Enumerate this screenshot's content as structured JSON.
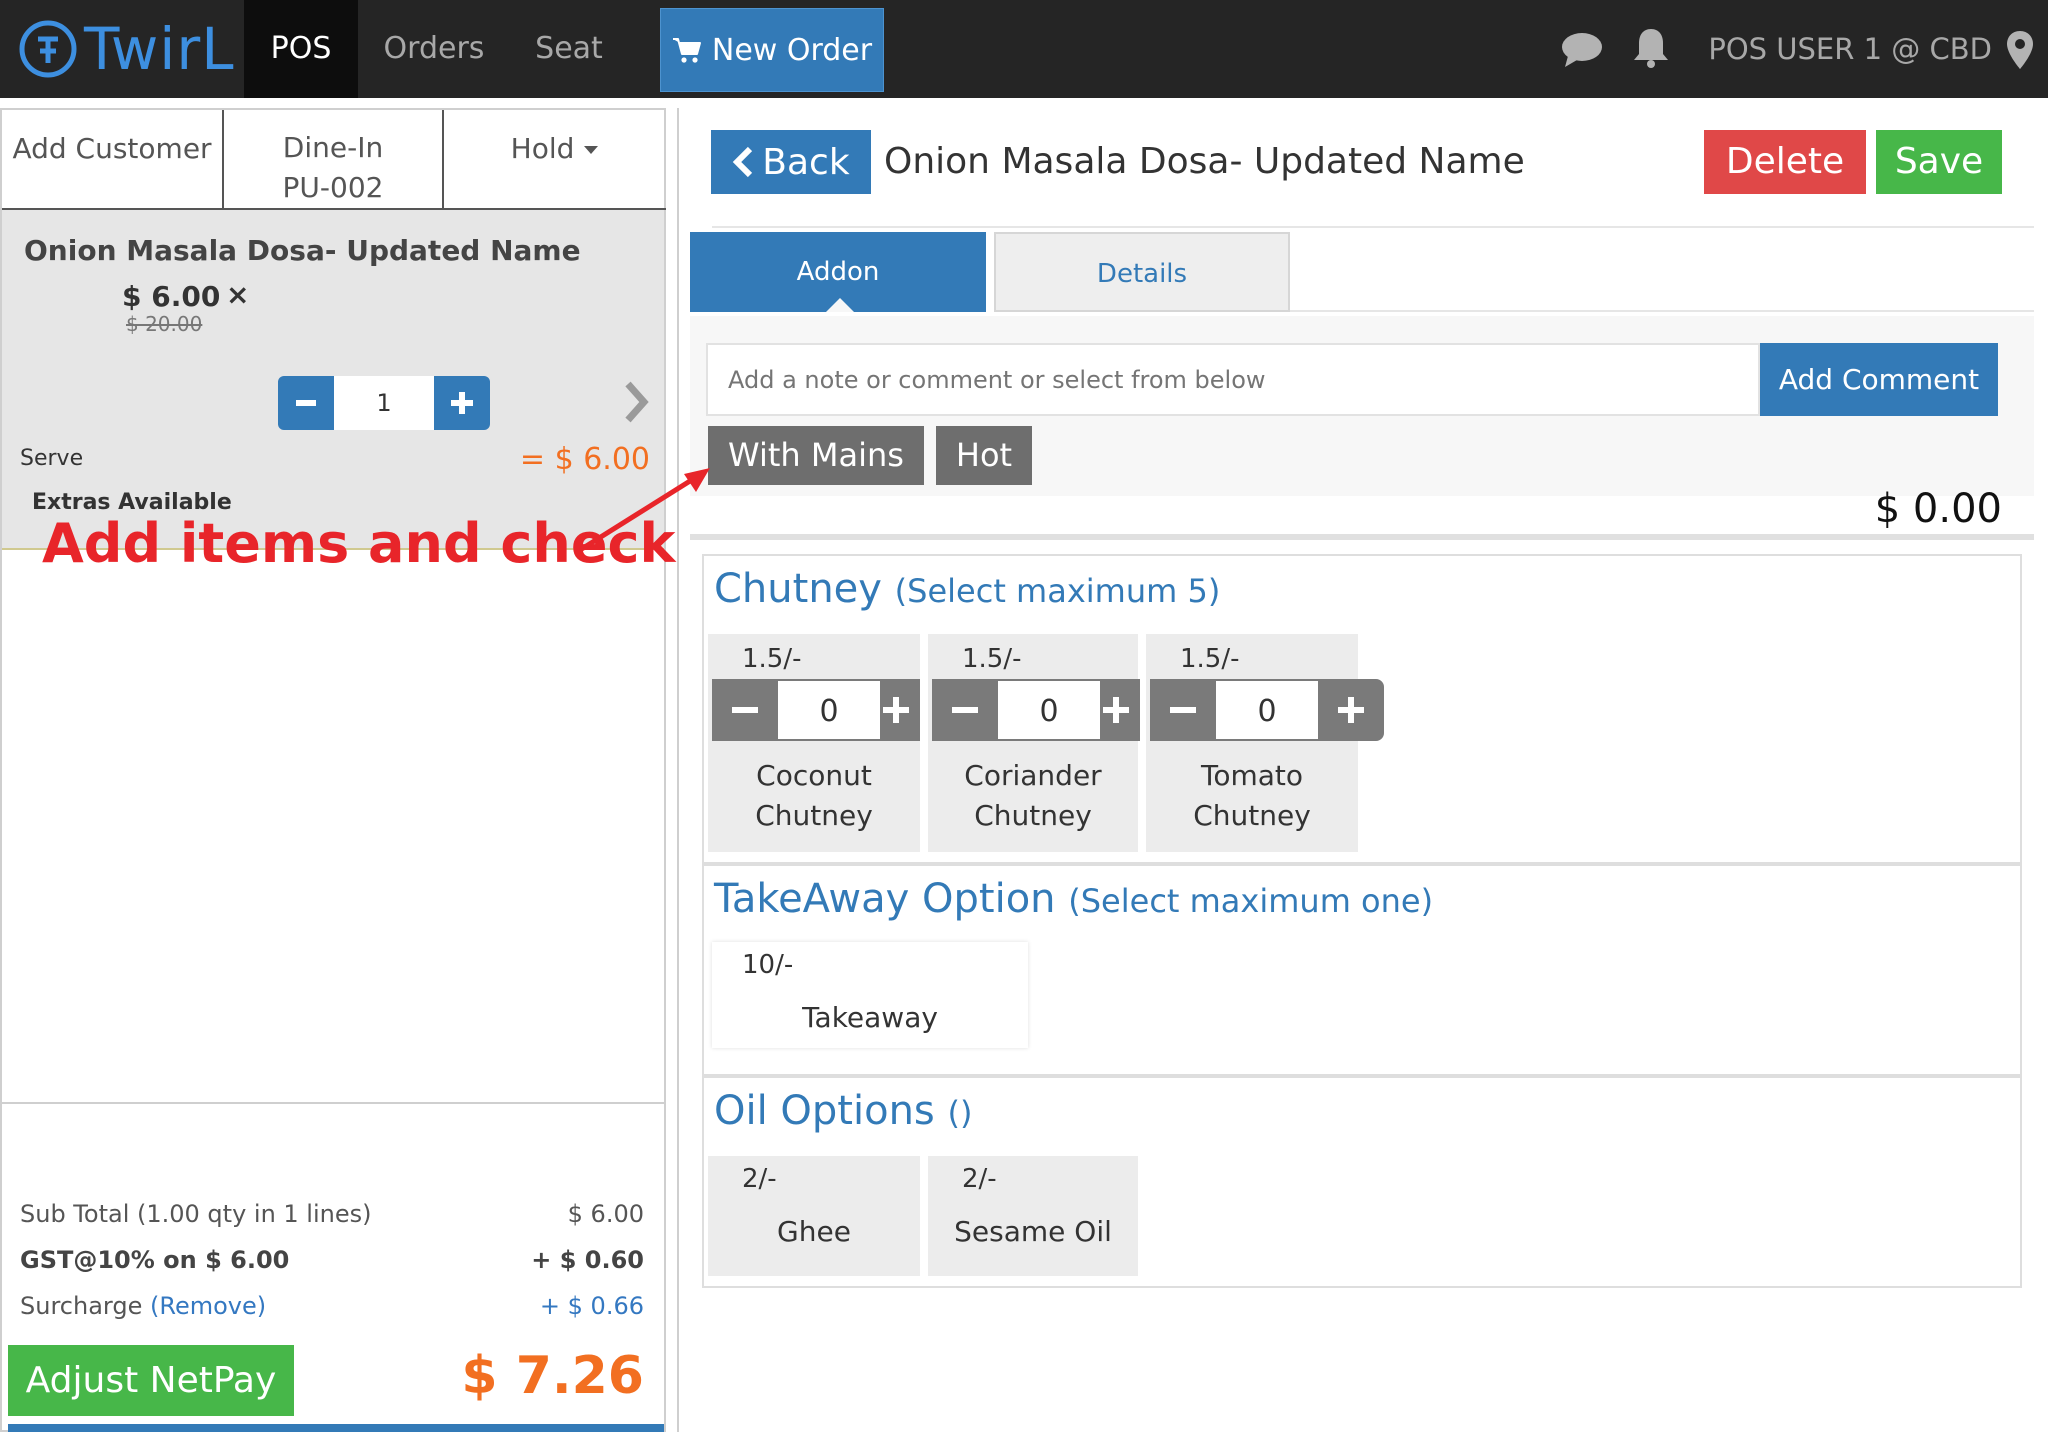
{
  "nav": {
    "logo": "TwirL",
    "tabs": [
      "POS",
      "Orders",
      "Seat"
    ],
    "new_order": "New Order",
    "user": "POS USER 1 @ CBD"
  },
  "order": {
    "tabs": {
      "customer": "Add Customer",
      "dine_in": "Dine-In",
      "dine_in_code": "PU-002",
      "hold": "Hold"
    },
    "item": {
      "name": "Onion Masala Dosa- Updated Name",
      "price": "$ 6.00",
      "old_price": "$ 20.00",
      "times": "×",
      "qty": "1",
      "serve": "Serve",
      "line_total": "= $ 6.00",
      "extras": "Extras Available"
    },
    "totals": {
      "subtotal_label": "Sub Total (1.00 qty in 1 lines)",
      "subtotal_value": "$ 6.00",
      "gst_label": "GST@10% on $ 6.00",
      "gst_value": "+ $ 0.60",
      "surcharge_label": "Surcharge",
      "surcharge_remove": "(Remove)",
      "surcharge_value": "+ $ 0.66",
      "adjust": "Adjust NetPay",
      "net": "$ 7.26"
    }
  },
  "editor": {
    "back": "Back",
    "title": "Onion Masala Dosa- Updated Name",
    "delete": "Delete",
    "save": "Save",
    "tabs": {
      "addon": "Addon",
      "details": "Details"
    },
    "comment_placeholder": "Add a note or comment or select from below",
    "add_comment": "Add Comment",
    "chips": [
      "With Mains",
      "Hot"
    ],
    "addon_total": "$ 0.00",
    "groups": {
      "chutney": {
        "title": "Chutney",
        "hint": "(Select maximum 5)",
        "options": [
          {
            "price": "1.5/-",
            "qty": "0",
            "name1": "Coconut",
            "name2": "Chutney"
          },
          {
            "price": "1.5/-",
            "qty": "0",
            "name1": "Coriander",
            "name2": "Chutney"
          },
          {
            "price": "1.5/-",
            "qty": "0",
            "name1": "Tomato",
            "name2": "Chutney"
          }
        ]
      },
      "takeaway": {
        "title": "TakeAway Option",
        "hint": "(Select maximum one)",
        "options": [
          {
            "price": "10/-",
            "name": "Takeaway"
          }
        ]
      },
      "oil": {
        "title": "Oil Options",
        "hint": "()",
        "options": [
          {
            "price": "2/-",
            "name": "Ghee"
          },
          {
            "price": "2/-",
            "name": "Sesame Oil"
          }
        ]
      }
    }
  },
  "annotation": "Add items and check",
  "colors": {
    "nav_bg": "#252525",
    "primary": "#337ab7",
    "danger": "#e04848",
    "success": "#47b749",
    "accent": "#f26f21",
    "annotation": "#e8252a"
  }
}
